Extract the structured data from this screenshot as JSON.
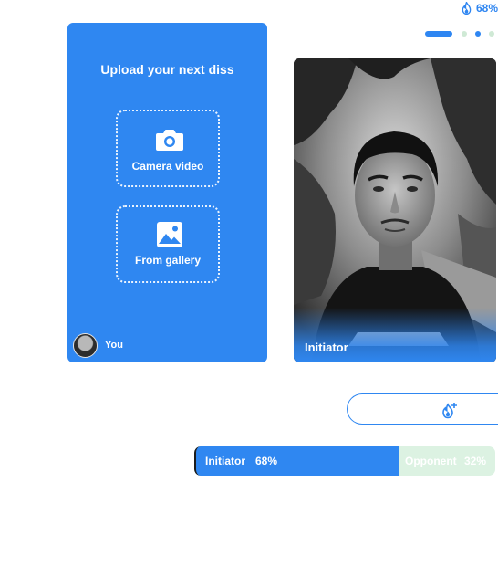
{
  "header": {
    "heat_icon": "flame-icon",
    "heat_percent": "68%",
    "pager": {
      "total": 4,
      "active_index": 0
    }
  },
  "upload_card": {
    "title": "Upload your next diss",
    "camera": {
      "icon": "camera-icon",
      "label": "Camera video"
    },
    "gallery": {
      "icon": "image-icon",
      "label": "From gallery"
    },
    "user_label": "You"
  },
  "video_card": {
    "label": "Initiator"
  },
  "react_button": {
    "icon": "flame-plus-icon"
  },
  "score": {
    "initiator_name": "Initiator",
    "initiator_percent": "68%",
    "initiator_share": 0.68,
    "opponent_name": "Opponent",
    "opponent_percent": "32%",
    "opponent_share": 0.32
  },
  "colors": {
    "accent": "#2f87f1",
    "opponent_bg": "#dcf2e2"
  }
}
